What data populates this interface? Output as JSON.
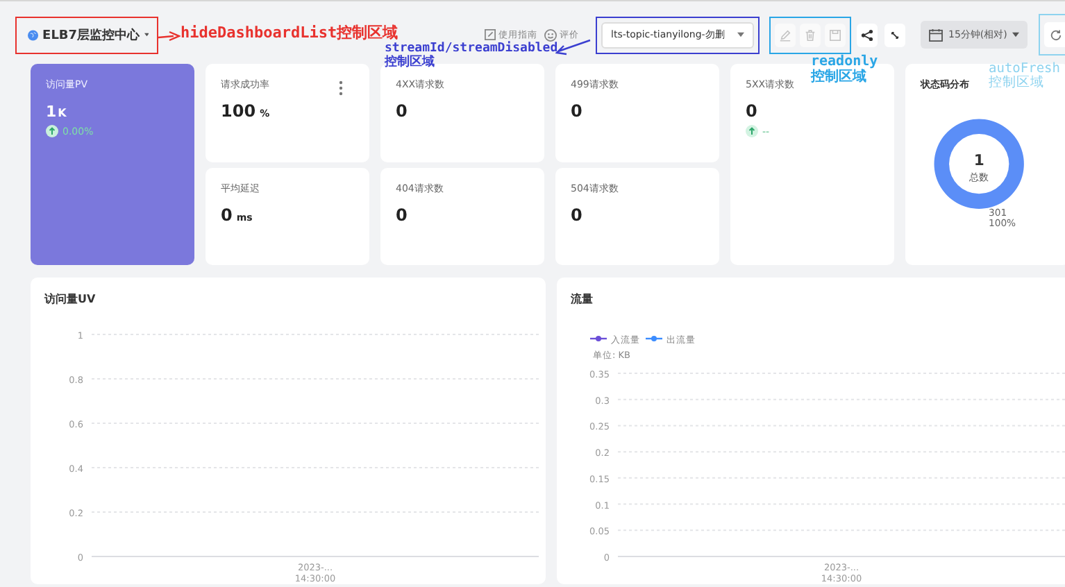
{
  "header": {
    "dashboard_title": "ELB7层监控中心",
    "guide_link": "使用指南",
    "rate_link": "评价",
    "stream_select": {
      "value": "lts-topic-tianyilong-勿删"
    },
    "readonly_actions": [
      {
        "kind": "edit",
        "disabled": true
      },
      {
        "kind": "delete",
        "disabled": true
      },
      {
        "kind": "save",
        "disabled": true
      }
    ],
    "time_range": "15分钟(相对)"
  },
  "annotations": [
    {
      "color": "#e8322e",
      "lines": [
        "hideDashboardList控制区域"
      ]
    },
    {
      "color": "#3b3fd0",
      "lines": [
        "streamId/streamDisabled",
        "控制区域"
      ]
    },
    {
      "color": "#2aa6e6",
      "lines": [
        "readonly",
        "控制区域"
      ]
    },
    {
      "color": "#8ed3ef",
      "lines": [
        "autoFresh",
        "控制区域"
      ]
    }
  ],
  "card_columns": [
    {
      "cards": [
        {
          "kind": "highlight",
          "title": "访问量PV",
          "value": "1",
          "unit": "K",
          "trend": "0.00%",
          "menu": false
        }
      ]
    },
    {
      "cards": [
        {
          "kind": "stat",
          "title": "请求成功率",
          "value": "100",
          "unit": "%",
          "menu": true
        },
        {
          "kind": "stat",
          "title": "平均延迟",
          "value": "0",
          "unit": "ms",
          "menu": false
        }
      ]
    },
    {
      "cards": [
        {
          "kind": "stat",
          "title": "4XX请求数",
          "value": "0",
          "menu": false
        },
        {
          "kind": "stat",
          "title": "404请求数",
          "value": "0",
          "menu": false
        }
      ]
    },
    {
      "cards": [
        {
          "kind": "stat",
          "title": "499请求数",
          "value": "0",
          "menu": false
        },
        {
          "kind": "stat",
          "title": "504请求数",
          "value": "0",
          "menu": false
        }
      ]
    },
    {
      "cards": [
        {
          "kind": "stat",
          "title": "5XX请求数",
          "value": "0",
          "trend": "--",
          "menu": false
        }
      ]
    },
    {
      "cards": [
        {
          "kind": "donut",
          "title": "状态码分布",
          "center_value": "1",
          "center_label": "总数",
          "chart_data": {
            "type": "donut",
            "categories": [
              "301"
            ],
            "values": [
              100
            ],
            "value_labels": [
              "100%"
            ]
          }
        }
      ]
    }
  ],
  "panels": [
    {
      "title": "访问量UV",
      "chart_data": {
        "type": "line",
        "categories": [
          "2023-... 14:30:00"
        ],
        "values": [
          null
        ],
        "grid": true,
        "ylim": [
          0,
          1
        ],
        "yticks": [
          0,
          0.2,
          0.4,
          0.6,
          0.8,
          1
        ]
      }
    },
    {
      "title": "流量",
      "chart_data": {
        "type": "line",
        "ylabel": "单位: KB",
        "categories": [
          "2023-... 14:30:00"
        ],
        "grid": true,
        "series": [
          {
            "name": "入流量",
            "color": "#6b4fd8",
            "values": [
              null
            ]
          },
          {
            "name": "出流量",
            "color": "#3b8cff",
            "values": [
              null
            ]
          }
        ],
        "ylim": [
          0,
          0.35
        ],
        "yticks": [
          0,
          0.05,
          0.1,
          0.15,
          0.2,
          0.25,
          0.3,
          0.35
        ]
      }
    }
  ]
}
